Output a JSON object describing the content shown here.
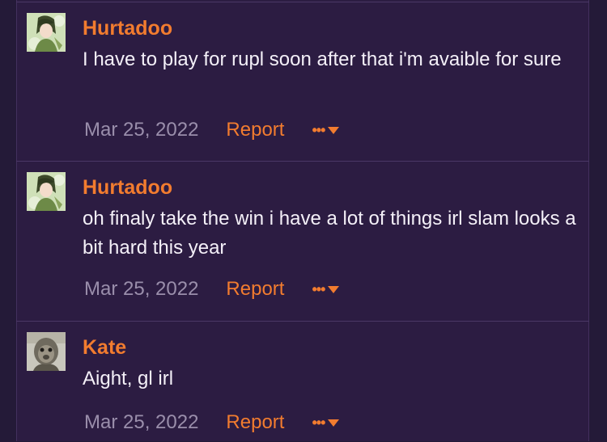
{
  "posts": [
    {
      "author": "Hurtadoo",
      "avatar_icon": "anime-character-avatar",
      "text": "I have to play for rupl soon after that i'm avaible for sure",
      "date": "Mar 25, 2022",
      "report_label": "Report",
      "more_label": "•••"
    },
    {
      "author": "Hurtadoo",
      "avatar_icon": "anime-character-avatar",
      "text": "oh finaly take the win i have a lot of things irl slam looks a bit hard this year",
      "date": "Mar 25, 2022",
      "report_label": "Report",
      "more_label": "•••"
    },
    {
      "author": "Kate",
      "avatar_icon": "monkey-avatar",
      "text": "Aight, gl irl",
      "date": "Mar 25, 2022",
      "report_label": "Report",
      "more_label": "•••"
    }
  ],
  "colors": {
    "background": "#241a38",
    "post_background": "#2c1c42",
    "accent": "#f27c2f",
    "text": "#f4f0f8",
    "muted": "#9a8eab",
    "divider": "#4a3766"
  }
}
